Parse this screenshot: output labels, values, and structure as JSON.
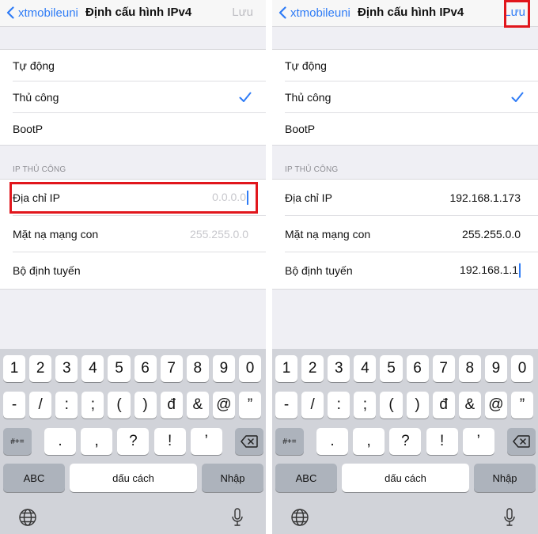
{
  "screens": [
    {
      "nav": {
        "back_label": "xtmobileuni",
        "title": "Định cấu hình IPv4",
        "save_label": "Lưu"
      },
      "modes": [
        {
          "label": "Tự động"
        },
        {
          "label": "Thủ công"
        },
        {
          "label": "BootP"
        }
      ],
      "section_header": "IP THỦ CÔNG",
      "fields": [
        {
          "label": "Địa chỉ IP",
          "value": "0.0.0.0"
        },
        {
          "label": "Mặt nạ mạng con",
          "value": "255.255.0.0"
        },
        {
          "label": "Bộ định tuyến",
          "value": ""
        }
      ]
    },
    {
      "nav": {
        "back_label": "xtmobileuni",
        "title": "Định cấu hình IPv4",
        "save_label": "Lưu"
      },
      "modes": [
        {
          "label": "Tự động"
        },
        {
          "label": "Thủ công"
        },
        {
          "label": "BootP"
        }
      ],
      "section_header": "IP THỦ CÔNG",
      "fields": [
        {
          "label": "Địa chỉ IP",
          "value": "192.168.1.173"
        },
        {
          "label": "Mặt nạ mạng con",
          "value": "255.255.0.0"
        },
        {
          "label": "Bộ định tuyến",
          "value": "192.168.1.1"
        }
      ]
    }
  ],
  "keyboard": {
    "row1": [
      "1",
      "2",
      "3",
      "4",
      "5",
      "6",
      "7",
      "8",
      "9",
      "0"
    ],
    "row2": [
      "-",
      "/",
      ":",
      ";",
      "(",
      ")",
      "đ",
      "&",
      "@",
      "”"
    ],
    "row3_left": "#+=",
    "row3": [
      ".",
      ",",
      "?",
      "!",
      "’"
    ],
    "abc_label": "ABC",
    "space_label": "dấu cách",
    "return_label": "Nhập"
  },
  "colors": {
    "accent": "#2f7cf6",
    "highlight": "#e1161c",
    "keyboard_bg": "#d1d3d9",
    "background": "#efeff4"
  }
}
